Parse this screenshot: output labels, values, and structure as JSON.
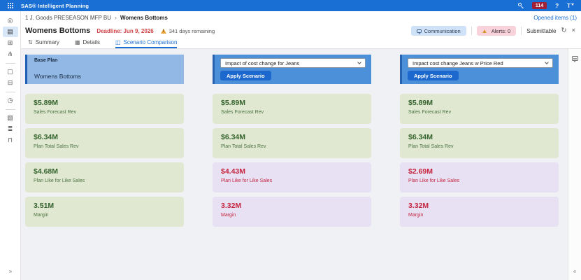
{
  "topbar": {
    "brand": "SAS® Intelligent Planning",
    "notification_count": "114",
    "help_label": "?",
    "avatar_label": "T"
  },
  "breadcrumb": {
    "root": "1 J. Goods PRESEASON MFP BU",
    "separator": "›",
    "current": "Womens Bottoms",
    "opened_items": "Opened items (1)"
  },
  "header": {
    "title": "Womens Bottoms",
    "deadline": "Deadline: Jun 9, 2026",
    "days_remaining": "341 days remaining",
    "communication": "Communication",
    "alerts": "Alerts: 0",
    "submittable": "Submittable"
  },
  "tabs": [
    {
      "label": "Summary",
      "glyph": "⇅",
      "active": false
    },
    {
      "label": "Details",
      "glyph": "▦",
      "active": false
    },
    {
      "label": "Scenario Comparison",
      "glyph": "◫",
      "active": true
    }
  ],
  "sidebar": {
    "icons": [
      {
        "name": "explore",
        "glyph": "◎"
      },
      {
        "name": "plans",
        "glyph": "▤"
      },
      {
        "name": "workbench",
        "glyph": "⊞"
      },
      {
        "name": "share",
        "glyph": "⋔"
      },
      {
        "name": "documents",
        "glyph": "▢"
      },
      {
        "name": "archive",
        "glyph": "⊟"
      },
      {
        "name": "history",
        "glyph": "◷"
      },
      {
        "name": "reports",
        "glyph": "▧"
      },
      {
        "name": "layers",
        "glyph": "≣"
      },
      {
        "name": "lock",
        "glyph": "⊓"
      }
    ],
    "expand": "»"
  },
  "rail": {
    "collapse": "«"
  },
  "icons": {
    "refresh": "↻",
    "close": "×"
  },
  "columns": [
    {
      "kind": "base",
      "title": "Base Plan",
      "subtitle": "Womens Bottoms",
      "cards": [
        {
          "value": "$5.89M",
          "label": "Sales Forecast Rev",
          "tone": "green"
        },
        {
          "value": "$6.34M",
          "label": "Plan Total Sales Rev",
          "tone": "green"
        },
        {
          "value": "$4.68M",
          "label": "Plan Like for Like Sales",
          "tone": "green"
        },
        {
          "value": "3.51M",
          "label": "Margin",
          "tone": "green"
        }
      ]
    },
    {
      "kind": "scenario",
      "scenario": "Impact of cost change for Jeans",
      "apply_label": "Apply Scenario",
      "cards": [
        {
          "value": "$5.89M",
          "label": "Sales Forecast Rev",
          "tone": "green"
        },
        {
          "value": "$6.34M",
          "label": "Plan Total Sales Rev",
          "tone": "green"
        },
        {
          "value": "$4.43M",
          "label": "Plan Like for Like Sales",
          "tone": "purple"
        },
        {
          "value": "3.32M",
          "label": "Margin",
          "tone": "purple"
        }
      ]
    },
    {
      "kind": "scenario",
      "scenario": "Impact cost change Jeans w Price Red",
      "apply_label": "Apply Scenario",
      "cards": [
        {
          "value": "$5.89M",
          "label": "Sales Forecast Rev",
          "tone": "green"
        },
        {
          "value": "$6.34M",
          "label": "Plan Total Sales Rev",
          "tone": "green"
        },
        {
          "value": "$2.69M",
          "label": "Plan Like for Like Sales",
          "tone": "purple"
        },
        {
          "value": "3.32M",
          "label": "Margin",
          "tone": "purple"
        }
      ]
    }
  ],
  "colors": {
    "topbar_blue": "#1a6fd4",
    "accent_blue": "#1a6dd3",
    "base_header_bg": "#92b9e5",
    "scenario_header_bg": "#4c90da",
    "apply_button_bg": "#1d68cc",
    "green_card_bg": "#e1e8d1",
    "green_text": "#35642e",
    "purple_card_bg": "#e8e0f3",
    "red_text": "#c5263f",
    "deadline_red": "#d04343",
    "badge_red": "#9e2139",
    "communication_pill_bg": "#cfe2f8",
    "alerts_pill_bg": "#f8d3dc"
  }
}
